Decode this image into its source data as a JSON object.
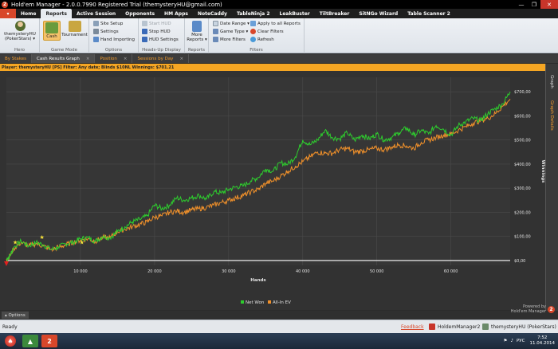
{
  "window": {
    "title": "Hold'em Manager - 2.0.0.7990 Registered Trial (themysteryHU@gmail.com)"
  },
  "menu_tabs": [
    "Home",
    "Reports",
    "Active Session",
    "Opponents",
    "HM Apps",
    "NoteCaddy",
    "TableNinja 2",
    "LeakBuster",
    "TiltBreaker",
    "SitNGo Wizard",
    "Table Scanner 2"
  ],
  "menu_active": "Reports",
  "ribbon": {
    "hero": {
      "name": "themysteryHU",
      "site": "(PokerStars) ▾",
      "title": "Hero"
    },
    "game_mode": {
      "cash": "Cash",
      "tournament": "Tournament",
      "title": "Game Mode"
    },
    "options": {
      "site_setup": "Site Setup",
      "settings": "Settings",
      "hand_importing": "Hand Importing",
      "title": "Options"
    },
    "hud": {
      "start": "Start HUD",
      "stop": "Stop HUD",
      "settings": "HUD Settings",
      "title": "Heads-Up Display"
    },
    "reports": {
      "more": "More",
      "reports": "Reports ▾",
      "title": "Reports"
    },
    "filters": {
      "date_range": "Date Range ▾",
      "game_type": "Game Type ▾",
      "more_filters": "More Filters",
      "apply_all": "Apply to all Reports",
      "clear": "Clear Filters",
      "refresh": "Refresh",
      "title": "Filters"
    }
  },
  "view_tabs": [
    "By Stakes",
    "Cash Results Graph",
    "Position",
    "Sessions by Day"
  ],
  "view_active": "Cash Results Graph",
  "filter_text": "Player: themysteryHU [PS]  Filter: Any date; Blinds $10NL  Winnings: $701.21",
  "side_panel": {
    "graph": "Graph",
    "graph_details": "Graph Details"
  },
  "options_label": "▴ Options",
  "powered_by": {
    "line1": "Powered by",
    "line2": "Hold'em Manager"
  },
  "status": {
    "ready": "Ready",
    "feedback": "Feedback",
    "app": "HoldemManager2",
    "player": "themysteryHU (PokerStars)"
  },
  "taskbar": {
    "lang": "РУС",
    "time": "7:52",
    "date": "11.04.2014"
  },
  "colors": {
    "net_won": "#2ecc2e",
    "all_in_ev": "#f0902a",
    "accent": "#f5a623",
    "brand": "#d8472a"
  },
  "chart_data": {
    "type": "line",
    "title": "",
    "xlabel": "Hands",
    "ylabel": "Winnings",
    "xlim": [
      0,
      68000
    ],
    "ylim": [
      -20,
      760
    ],
    "x_ticks": [
      10000,
      20000,
      30000,
      40000,
      50000,
      60000
    ],
    "x_tick_labels": [
      "10 000",
      "20 000",
      "30 000",
      "40 000",
      "50 000",
      "60 000"
    ],
    "y_ticks": [
      0,
      100,
      200,
      300,
      400,
      500,
      600,
      700
    ],
    "y_tick_labels": [
      "$0,00",
      "$100,00",
      "$200,00",
      "$300,00",
      "$400,00",
      "$500,00",
      "$600,00",
      "$700,00"
    ],
    "grid": true,
    "legend": "bottom-center",
    "x": [
      0,
      500,
      1000,
      2000,
      3000,
      4000,
      5000,
      6000,
      7000,
      8000,
      9000,
      10000,
      11000,
      12000,
      13000,
      14000,
      15000,
      16000,
      17000,
      18000,
      19000,
      20000,
      21000,
      22000,
      23000,
      24000,
      25000,
      26000,
      27000,
      28000,
      29000,
      30000,
      31000,
      32000,
      33000,
      34000,
      35000,
      36000,
      37000,
      38000,
      39000,
      40000,
      41000,
      42000,
      43000,
      44000,
      45000,
      46000,
      47000,
      48000,
      49000,
      50000,
      51000,
      52000,
      53000,
      54000,
      55000,
      56000,
      57000,
      58000,
      59000,
      60000,
      61000,
      62000,
      63000,
      64000,
      65000,
      66000,
      67000,
      68000
    ],
    "series": [
      {
        "name": "Net Won",
        "values": [
          5,
          20,
          55,
          80,
          60,
          75,
          65,
          45,
          55,
          70,
          75,
          90,
          95,
          80,
          100,
          95,
          120,
          140,
          160,
          170,
          185,
          230,
          215,
          230,
          260,
          250,
          260,
          270,
          255,
          285,
          280,
          295,
          305,
          310,
          330,
          345,
          380,
          370,
          405,
          400,
          430,
          500,
          480,
          500,
          540,
          510,
          505,
          530,
          500,
          520,
          505,
          525,
          500,
          510,
          530,
          550,
          520,
          540,
          525,
          560,
          545,
          520,
          560,
          575,
          590,
          580,
          610,
          630,
          650,
          700
        ]
      },
      {
        "name": "All-In EV",
        "values": [
          5,
          20,
          50,
          75,
          60,
          70,
          60,
          45,
          55,
          65,
          75,
          85,
          90,
          80,
          95,
          95,
          120,
          130,
          140,
          150,
          160,
          180,
          185,
          200,
          205,
          200,
          210,
          215,
          220,
          230,
          240,
          250,
          260,
          270,
          285,
          295,
          320,
          330,
          350,
          370,
          390,
          410,
          430,
          450,
          445,
          445,
          460,
          465,
          450,
          455,
          460,
          465,
          460,
          470,
          480,
          475,
          465,
          490,
          500,
          510,
          520,
          525,
          540,
          555,
          570,
          580,
          590,
          610,
          640,
          670
        ]
      }
    ]
  }
}
